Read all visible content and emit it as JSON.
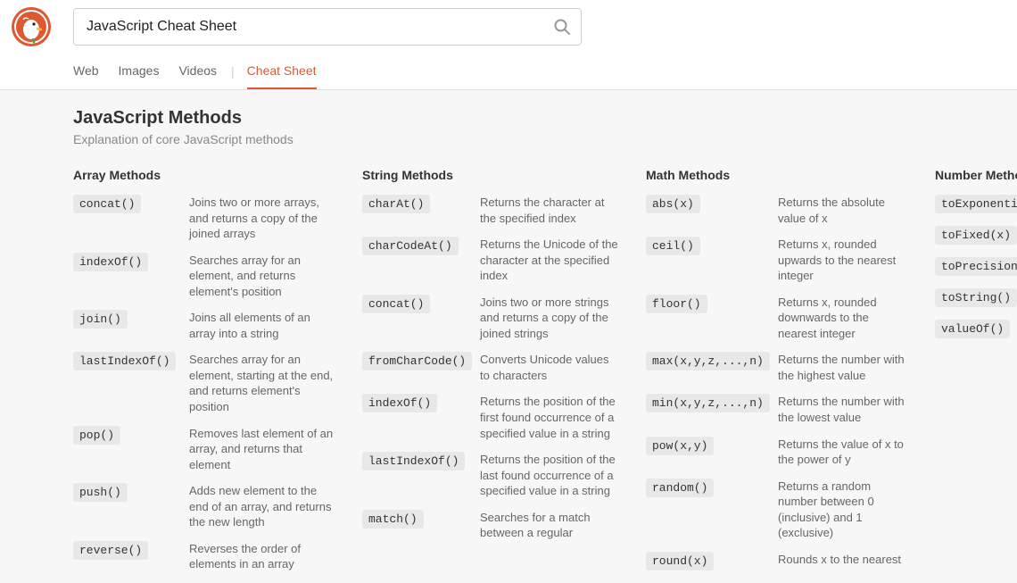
{
  "search": {
    "value": "JavaScript Cheat Sheet",
    "placeholder": ""
  },
  "tabs": {
    "items": [
      "Web",
      "Images",
      "Videos"
    ],
    "active": "Cheat Sheet"
  },
  "page": {
    "title": "JavaScript Methods",
    "subtitle": "Explanation of core JavaScript methods"
  },
  "columns": [
    {
      "title": "Array Methods",
      "rows": [
        {
          "code": "concat()",
          "desc": "Joins two or more arrays, and returns a copy of the joined arrays"
        },
        {
          "code": "indexOf()",
          "desc": "Searches array for an element, and returns element's position"
        },
        {
          "code": "join()",
          "desc": "Joins all elements of an array into a string"
        },
        {
          "code": "lastIndexOf()",
          "desc": "Searches array for an element, starting at the end, and returns element's position"
        },
        {
          "code": "pop()",
          "desc": "Removes last element of an array, and returns that element"
        },
        {
          "code": "push()",
          "desc": "Adds new element to the end of an array, and returns the new length"
        },
        {
          "code": "reverse()",
          "desc": "Reverses the order of elements in an array"
        }
      ]
    },
    {
      "title": "String Methods",
      "rows": [
        {
          "code": "charAt()",
          "desc": "Returns the character at the specified index"
        },
        {
          "code": "charCodeAt()",
          "desc": "Returns the Unicode of the character at the specified index"
        },
        {
          "code": "concat()",
          "desc": "Joins two or more strings and returns a copy of the joined strings"
        },
        {
          "code": "fromCharCode()",
          "desc": "Converts Unicode values to characters"
        },
        {
          "code": "indexOf()",
          "desc": "Returns the position of the first found occurrence of a specified value in a string"
        },
        {
          "code": "lastIndexOf()",
          "desc": "Returns the position of the last found occurrence of a specified value in a string"
        },
        {
          "code": "match()",
          "desc": "Searches for a match between a regular"
        }
      ]
    },
    {
      "title": "Math Methods",
      "rows": [
        {
          "code": "abs(x)",
          "desc": "Returns the absolute value of x"
        },
        {
          "code": "ceil()",
          "desc": "Returns x, rounded upwards to the nearest integer"
        },
        {
          "code": "floor()",
          "desc": "Returns x, rounded downwards to the nearest integer"
        },
        {
          "code": "max(x,y,z,...,n)",
          "desc": "Returns the number with the highest value"
        },
        {
          "code": "min(x,y,z,...,n)",
          "desc": "Returns the number with the lowest value"
        },
        {
          "code": "pow(x,y)",
          "desc": "Returns the value of x to the power of y"
        },
        {
          "code": "random()",
          "desc": "Returns a random number between 0 (inclusive) and 1 (exclusive)"
        },
        {
          "code": "round(x)",
          "desc": "Rounds x to the nearest"
        }
      ]
    },
    {
      "title": "Number Methods",
      "rows": [
        {
          "code": "toExponential(x)"
        },
        {
          "code": "toFixed(x)"
        },
        {
          "code": "toPrecision(x)"
        },
        {
          "code": "toString()"
        },
        {
          "code": "valueOf()"
        }
      ]
    }
  ]
}
